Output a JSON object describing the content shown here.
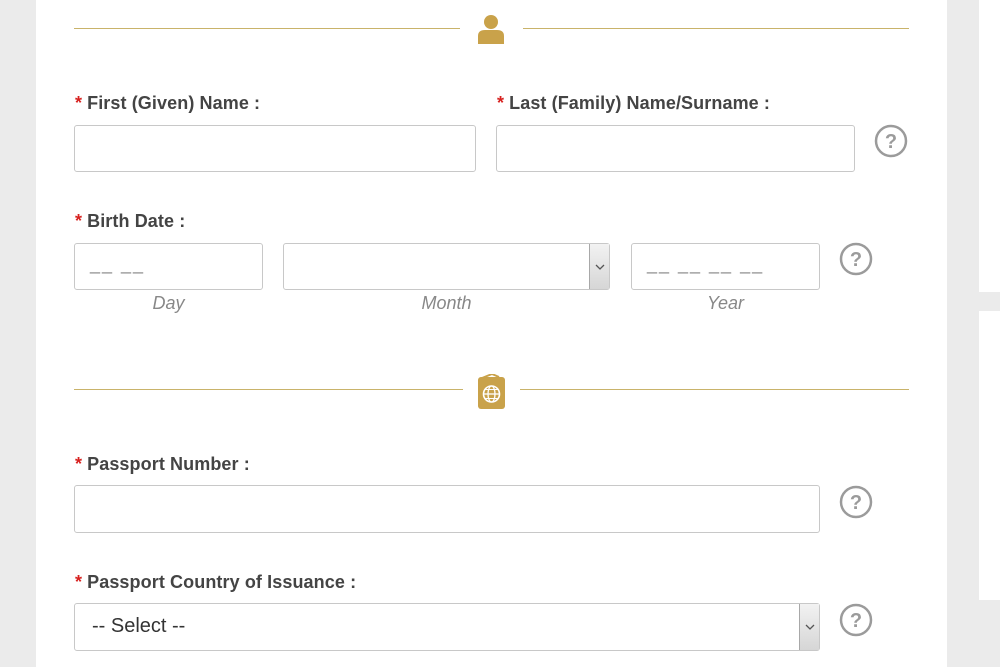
{
  "personal": {
    "icon": "person-icon",
    "first_name": {
      "required_mark": "*",
      "label": "First (Given) Name :",
      "value": ""
    },
    "last_name": {
      "required_mark": "*",
      "label": "Last (Family) Name/Surname :",
      "value": ""
    },
    "birth_date": {
      "required_mark": "*",
      "label": "Birth Date :",
      "day": {
        "placeholder": "__ __",
        "caption": "Day"
      },
      "month": {
        "value": "",
        "caption": "Month"
      },
      "year": {
        "placeholder": "__ __ __ __",
        "caption": "Year"
      }
    }
  },
  "passport": {
    "icon": "passport-icon",
    "number": {
      "required_mark": "*",
      "label": "Passport Number :",
      "value": ""
    },
    "country": {
      "required_mark": "*",
      "label": "Passport Country of Issuance :",
      "selected": "-- Select --"
    }
  },
  "colors": {
    "accent_gold": "#c9a24a",
    "required_red": "#d7211f",
    "help_gray": "#9b9b9b"
  }
}
